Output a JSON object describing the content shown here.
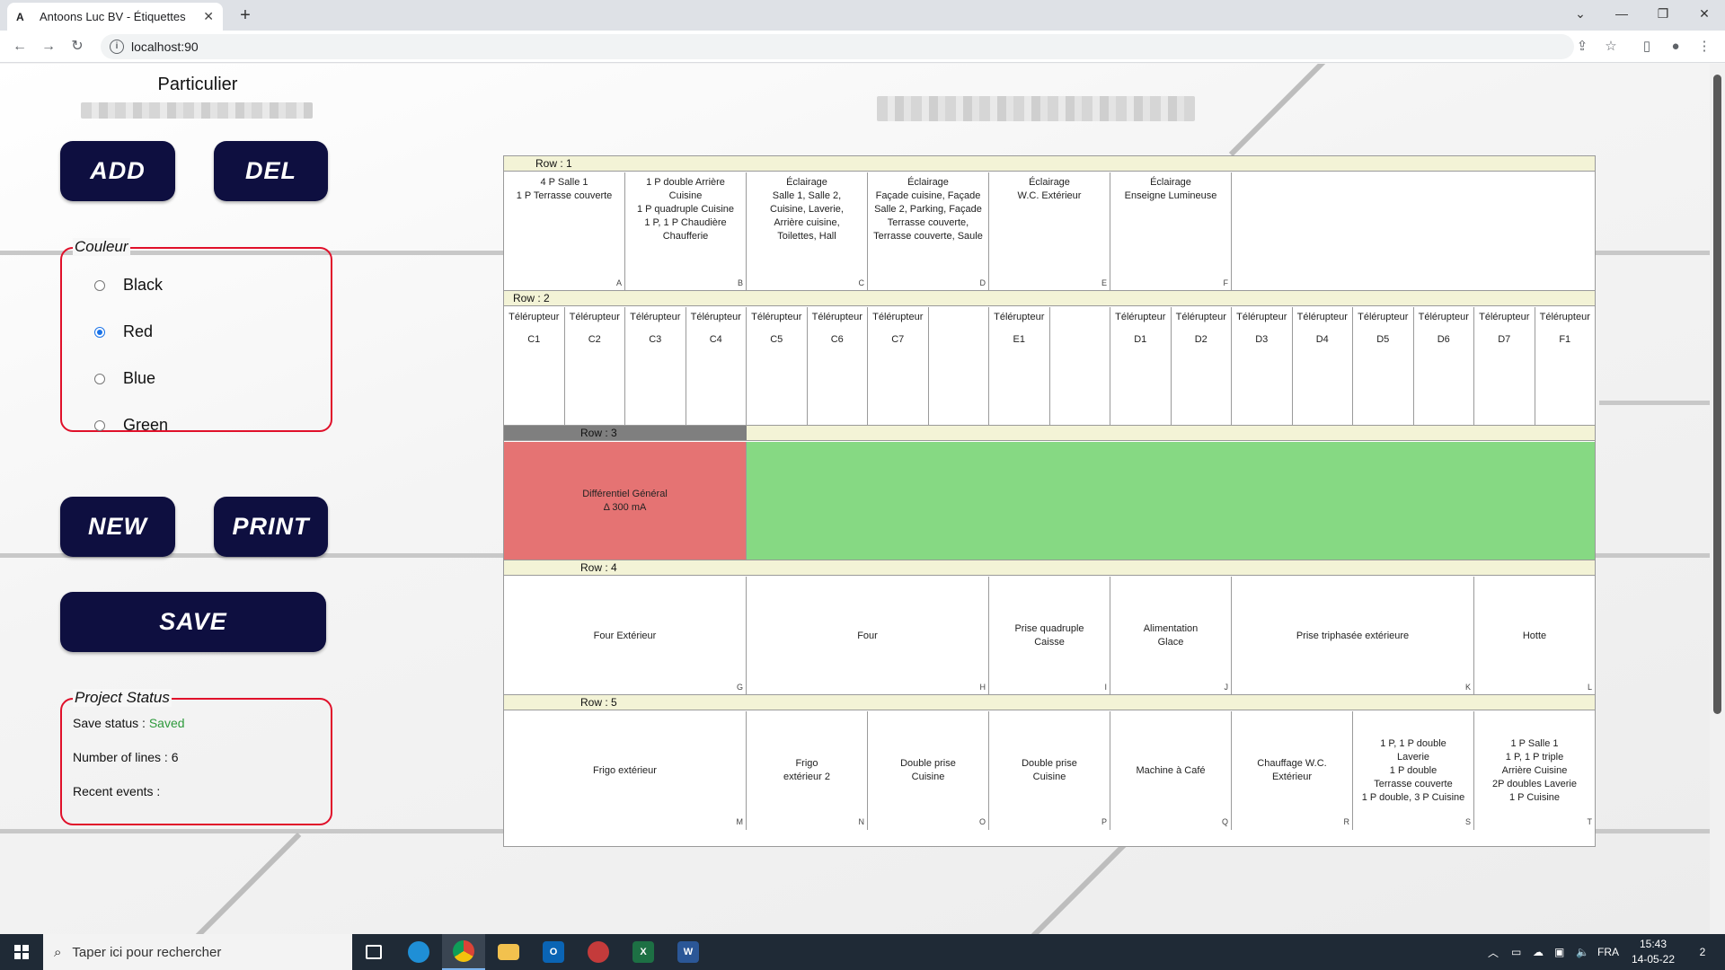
{
  "browser": {
    "tab_icon": "A",
    "tab_title": "Antoons Luc BV - Étiquettes",
    "tab_close": "✕",
    "new_tab": "+",
    "url": "localhost:90",
    "window_controls": [
      "⌄",
      "—",
      "❐",
      "✕"
    ]
  },
  "sidebar": {
    "client_type": "Particulier",
    "buttons": {
      "add": "ADD",
      "del": "DEL",
      "new": "NEW",
      "print": "PRINT",
      "save": "SAVE"
    },
    "color_group": {
      "legend": "Couleur",
      "options": [
        "Black",
        "Red",
        "Blue",
        "Green"
      ],
      "selected": "Red"
    },
    "project_status": {
      "legend": "Project Status",
      "save_status_label": "Save status : ",
      "save_status_value": "Saved",
      "save_status_color": "#2e9a3c",
      "lines_label": "Number of lines : 6",
      "recent_label": "Recent events :"
    }
  },
  "board": {
    "rows": [
      {
        "label": "Row : 1",
        "cells": [
          {
            "text": "4 P Salle 1\n1 P Terrasse couverte",
            "tag": "A"
          },
          {
            "text": "1 P double Arrière\nCuisine\n1 P quadruple Cuisine\n1 P, 1 P Chaudière\nChaufferie",
            "tag": "B"
          },
          {
            "text": "Éclairage\nSalle 1, Salle 2,\nCuisine, Laverie,\nArrière cuisine,\nToilettes, Hall",
            "tag": "C"
          },
          {
            "text": "Éclairage\nFaçade cuisine, Façade\nSalle 2, Parking, Façade\nTerrasse couverte,\nTerrasse couverte, Saule",
            "tag": "D"
          },
          {
            "text": "Éclairage\nW.C. Extérieur",
            "tag": "E"
          },
          {
            "text": "Éclairage\nEnseigne Lumineuse",
            "tag": "F"
          }
        ]
      },
      {
        "label": "Row : 2",
        "cells": [
          {
            "text": "Télérupteur",
            "sub": "C1"
          },
          {
            "text": "Télérupteur",
            "sub": "C2"
          },
          {
            "text": "Télérupteur",
            "sub": "C3"
          },
          {
            "text": "Télérupteur",
            "sub": "C4"
          },
          {
            "text": "Télérupteur",
            "sub": "C5"
          },
          {
            "text": "Télérupteur",
            "sub": "C6"
          },
          {
            "text": "Télérupteur",
            "sub": "C7"
          },
          {
            "text": "",
            "sub": ""
          },
          {
            "text": "Télérupteur",
            "sub": "E1"
          },
          {
            "text": "",
            "sub": ""
          },
          {
            "text": "Télérupteur",
            "sub": "D1"
          },
          {
            "text": "Télérupteur",
            "sub": "D2"
          },
          {
            "text": "Télérupteur",
            "sub": "D3"
          },
          {
            "text": "Télérupteur",
            "sub": "D4"
          },
          {
            "text": "Télérupteur",
            "sub": "D5"
          },
          {
            "text": "Télérupteur",
            "sub": "D6"
          },
          {
            "text": "Télérupteur",
            "sub": "D7"
          },
          {
            "text": "Télérupteur",
            "sub": "F1"
          }
        ]
      },
      {
        "label": "Row : 3",
        "cells": [
          {
            "text": "Différentiel Général\nΔ 300 mA",
            "color": "#e57373"
          },
          {
            "text": "",
            "color": "#86d983"
          }
        ]
      },
      {
        "label": "Row : 4",
        "cells": [
          {
            "text": "Four Extérieur",
            "tag": "G"
          },
          {
            "text": "Four",
            "tag": "H"
          },
          {
            "text": "Prise quadruple\nCaisse",
            "tag": "I"
          },
          {
            "text": "Alimentation\nGlace",
            "tag": "J"
          },
          {
            "text": "Prise triphasée extérieure",
            "tag": "K"
          },
          {
            "text": "Hotte",
            "tag": "L"
          }
        ]
      },
      {
        "label": "Row : 5",
        "cells": [
          {
            "text": "Frigo extérieur",
            "tag": "M"
          },
          {
            "text": "Frigo\nextérieur 2",
            "tag": "N"
          },
          {
            "text": "Double prise\nCuisine",
            "tag": "O"
          },
          {
            "text": "Double prise\nCuisine",
            "tag": "P"
          },
          {
            "text": "Machine à Café",
            "tag": "Q"
          },
          {
            "text": "Chauffage W.C.\nExtérieur",
            "tag": "R"
          },
          {
            "text": "1 P, 1 P double\nLaverie\n1 P double\nTerrasse couverte\n1 P double, 3 P Cuisine",
            "tag": "S"
          },
          {
            "text": "1 P Salle 1\n1 P, 1 P triple\nArrière Cuisine\n2P doubles Laverie\n1 P Cuisine",
            "tag": "T"
          }
        ]
      }
    ]
  },
  "taskbar": {
    "search_placeholder": "Taper ici pour rechercher",
    "language": "FRA",
    "time": "15:43",
    "date": "14-05-22",
    "notifications": "2"
  }
}
